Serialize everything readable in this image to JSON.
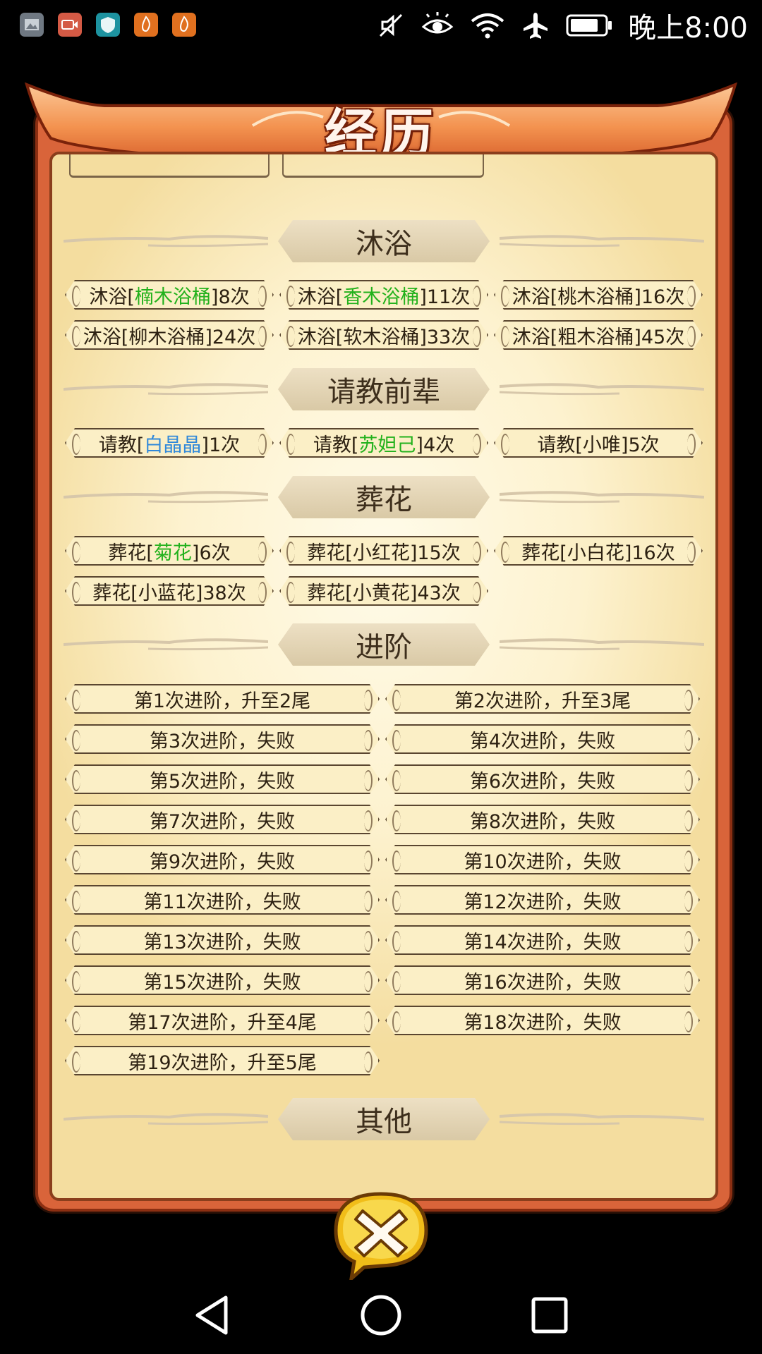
{
  "status_bar": {
    "time": "晚上8:00",
    "app_icons": [
      {
        "name": "gallery-app-icon",
        "color": "#6f7882"
      },
      {
        "name": "video-app-icon",
        "color": "#d45a45"
      },
      {
        "name": "shield-app-icon",
        "color": "#1d93a0"
      },
      {
        "name": "fire-app-icon",
        "color": "#e0701f"
      },
      {
        "name": "fire-app-icon-2",
        "color": "#e0701f"
      }
    ],
    "indicators": [
      "mute-icon",
      "eye-icon",
      "wifi-icon",
      "airplane-icon",
      "battery-icon"
    ]
  },
  "dialog": {
    "title": "经历",
    "colors": {
      "frame": "#d9643a",
      "paper": "#fdf2cf",
      "chip": "#fbefc6",
      "highlight_green": "#22b11c",
      "highlight_blue": "#2f88da"
    }
  },
  "sections": {
    "bath": {
      "title": "沐浴",
      "items": [
        {
          "pre": "沐浴[",
          "hl": "楠木浴桶",
          "hl_color": "green",
          "post": "]8次"
        },
        {
          "pre": "沐浴[",
          "hl": "香木浴桶",
          "hl_color": "green",
          "post": "]11次"
        },
        {
          "pre": "沐浴[桃木浴桶]16次",
          "hl": "",
          "post": ""
        },
        {
          "pre": "沐浴[柳木浴桶]24次",
          "hl": "",
          "post": ""
        },
        {
          "pre": "沐浴[软木浴桶]33次",
          "hl": "",
          "post": ""
        },
        {
          "pre": "沐浴[粗木浴桶]45次",
          "hl": "",
          "post": ""
        }
      ]
    },
    "consult": {
      "title": "请教前辈",
      "items": [
        {
          "pre": "请教[",
          "hl": "白晶晶",
          "hl_color": "blue",
          "post": "]1次"
        },
        {
          "pre": "请教[",
          "hl": "苏妲己",
          "hl_color": "green",
          "post": "]4次"
        },
        {
          "pre": "请教[小唯]5次",
          "hl": "",
          "post": ""
        }
      ]
    },
    "flowers": {
      "title": "葬花",
      "items": [
        {
          "pre": "葬花[",
          "hl": "菊花",
          "hl_color": "green",
          "post": "]6次"
        },
        {
          "pre": "葬花[小红花]15次",
          "hl": "",
          "post": ""
        },
        {
          "pre": "葬花[小白花]16次",
          "hl": "",
          "post": ""
        },
        {
          "pre": "葬花[小蓝花]38次",
          "hl": "",
          "post": ""
        },
        {
          "pre": "葬花[小黄花]43次",
          "hl": "",
          "post": ""
        }
      ]
    },
    "advance": {
      "title": "进阶",
      "items": [
        "第1次进阶，升至2尾",
        "第2次进阶，升至3尾",
        "第3次进阶，失败",
        "第4次进阶，失败",
        "第5次进阶，失败",
        "第6次进阶，失败",
        "第7次进阶，失败",
        "第8次进阶，失败",
        "第9次进阶，失败",
        "第10次进阶，失败",
        "第11次进阶，失败",
        "第12次进阶，失败",
        "第13次进阶，失败",
        "第14次进阶，失败",
        "第15次进阶，失败",
        "第16次进阶，失败",
        "第17次进阶，升至4尾",
        "第18次进阶，失败",
        "第19次进阶，升至5尾"
      ]
    },
    "other": {
      "title": "其他"
    }
  },
  "close_button": {
    "icon": "close-icon"
  },
  "nav_bar": {
    "buttons": [
      "back-icon",
      "home-icon",
      "recents-icon"
    ]
  }
}
